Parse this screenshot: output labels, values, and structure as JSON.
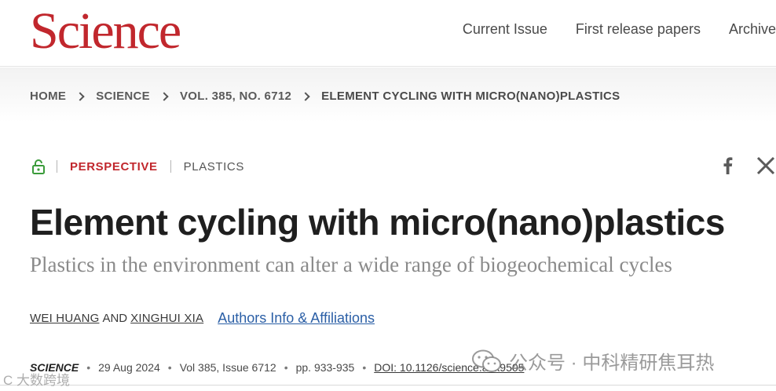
{
  "header": {
    "logo": "Science",
    "nav": [
      "Current Issue",
      "First release papers",
      "Archive"
    ]
  },
  "breadcrumb": [
    "HOME",
    "SCIENCE",
    "VOL. 385, NO. 6712",
    "ELEMENT CYCLING WITH MICRO(NANO)PLASTICS"
  ],
  "article": {
    "type": "PERSPECTIVE",
    "topic": "PLASTICS",
    "title": "Element cycling with micro(nano)plastics",
    "subtitle": "Plastics in the environment can alter a wide range of biogeochemical cycles",
    "authors": [
      "WEI HUANG",
      "XINGHUI XIA"
    ],
    "and": "AND",
    "affiliations_link": "Authors Info & Affiliations"
  },
  "citation": {
    "journal": "SCIENCE",
    "date": "29 Aug 2024",
    "volume": "Vol 385, Issue 6712",
    "pages": "pp. 933-935",
    "doi": "DOI: 10.1126/science.adk9505",
    "separator": "•"
  },
  "social": [
    "facebook-icon",
    "x-icon"
  ],
  "watermarks": {
    "right": "公众号 · 中科精研焦耳热",
    "left": "C 大数跨境"
  },
  "colors": {
    "brand_red": "#c1272d",
    "link_blue": "#2b5fa6",
    "lock_green": "#3a9b3a"
  }
}
